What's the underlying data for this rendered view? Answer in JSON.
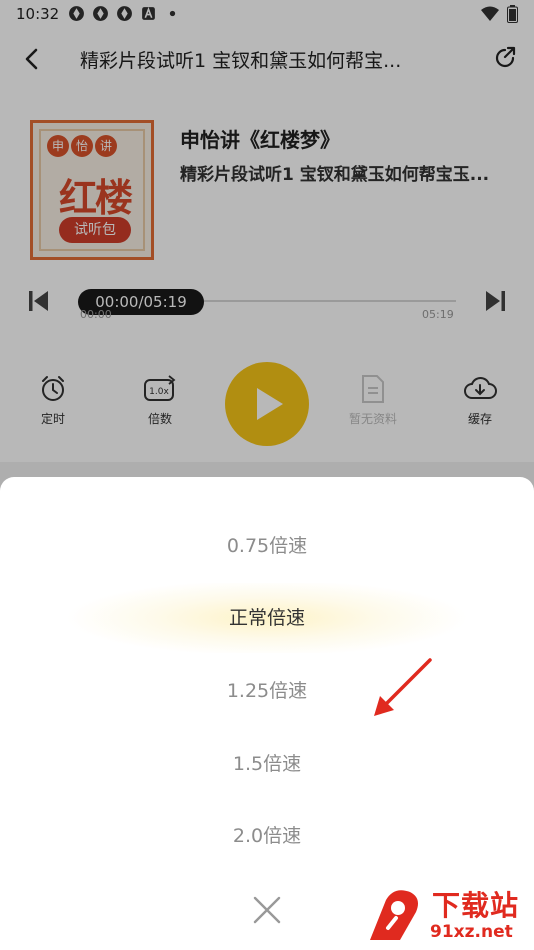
{
  "status_bar": {
    "time": "10:32",
    "left_icons": [
      "notification-icon",
      "notification-icon",
      "notification-icon",
      "a-badge-icon",
      "dot-icon"
    ],
    "right_icons": [
      "wifi-icon",
      "battery-icon"
    ]
  },
  "header": {
    "title": "精彩片段试听1 宝钗和黛玉如何帮宝...",
    "back_icon": "back-arrow-icon",
    "share_icon": "share-icon"
  },
  "cover": {
    "top_chars": [
      "申",
      "怡",
      "讲"
    ],
    "main_text": "红楼",
    "pill_text": "试听包"
  },
  "album": {
    "title": "申怡讲《红楼梦》",
    "track": "精彩片段试听1 宝钗和黛玉如何帮宝玉..."
  },
  "progress": {
    "current_display": "00:00/05:19",
    "start_label": "00:00",
    "end_label": "05:19",
    "fraction": 0
  },
  "controls": {
    "timer": "定时",
    "speed": "倍数",
    "speed_badge": "1.0x",
    "materials": "暂无资料",
    "download": "缓存"
  },
  "speed_sheet": {
    "options": [
      {
        "label": "0.75倍速",
        "selected": false
      },
      {
        "label": "正常倍速",
        "selected": true
      },
      {
        "label": "1.25倍速",
        "selected": false
      },
      {
        "label": "1.5倍速",
        "selected": false
      },
      {
        "label": "2.0倍速",
        "selected": false
      }
    ],
    "close_icon": "close-icon"
  },
  "watermark": {
    "text": "下载站",
    "url": "91xz.net"
  },
  "colors": {
    "accent_yellow": "#f5c518",
    "annotation_red": "#e02a1f",
    "selected_glow": "#fdf3c7"
  }
}
